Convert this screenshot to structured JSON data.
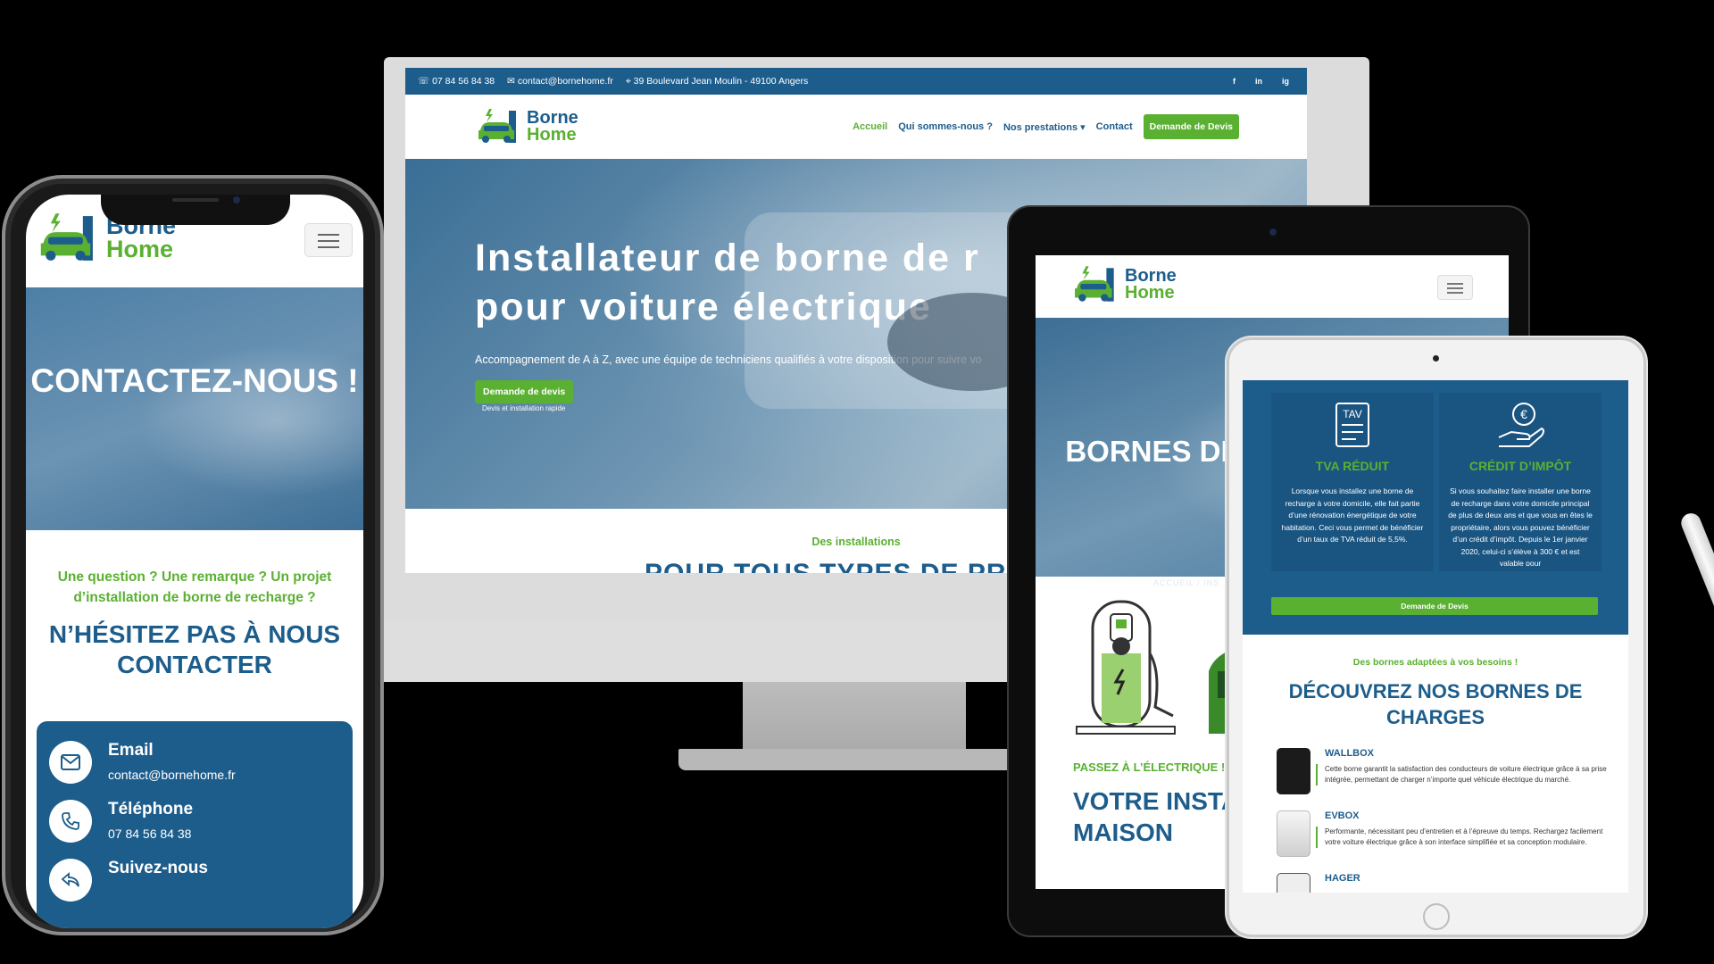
{
  "brand": {
    "line1": "Borne",
    "line2": "Home",
    "blue": "#1d5d8c",
    "green": "#5ab031"
  },
  "desktop": {
    "topbar": {
      "phone": "07 84 56 84 38",
      "email": "contact@bornehome.fr",
      "address": "39 Boulevard Jean Moulin - 49100 Angers",
      "social": [
        "f",
        "in",
        "ig"
      ]
    },
    "nav": {
      "items": [
        "Accueil",
        "Qui sommes-nous ?",
        "Nos prestations",
        "Contact"
      ],
      "cta": "Demande de Devis"
    },
    "hero": {
      "title_line1": "Installateur de borne de r",
      "title_line2": "pour voiture électrique",
      "subtitle": "Accompagnement de A à Z, avec une équipe de techniciens qualifiés à votre disposition pour suivre vo",
      "button": "Demande de devis",
      "note": "Devis et installation rapide"
    },
    "section": {
      "kicker": "Des installations",
      "title": "POUR TOUS TYPES DE PRO"
    }
  },
  "phone": {
    "hero_title": "CONTACTEZ-NOUS !",
    "question": "Une question ? Une remarque ? Un projet d’installation de borne de recharge ?",
    "cta_title": "N’HÉSITEZ PAS À NOUS CONTACTER",
    "contacts": [
      {
        "label": "Email",
        "value": "contact@bornehome.fr",
        "icon": "mail-icon"
      },
      {
        "label": "Téléphone",
        "value": "07 84 56 84 38",
        "icon": "phone-icon"
      },
      {
        "label": "Suivez-nous",
        "value": "",
        "icon": "share-icon"
      }
    ]
  },
  "tablet": {
    "hero_title": "BORNES DE MAISON",
    "breadcrumb": "ACCUEIL  /  INS",
    "kicker": "PASSEZ À L’ÉLECTRIQUE !",
    "title": "VOTRE INSTA BORNE DE R MAISON"
  },
  "ipad": {
    "columns": [
      {
        "heading": "TVA RÉDUIT",
        "icon_label": "TAV",
        "text": "Lorsque vous installez une borne de recharge à votre domicile, elle fait partie d’une rénovation énergétique de votre habitation. Ceci vous permet de bénéficier d’un taux de TVA réduit de 5,5%."
      },
      {
        "heading": "CRÉDIT D’IMPÔT",
        "icon_label": "€",
        "text": "Si vous souhaitez faire installer une borne de recharge dans votre domicile principal de plus de deux ans et que vous en êtes le propriétaire, alors vous pouvez bénéficier d’un crédit d’impôt. Depuis le 1er janvier 2020, celui-ci s’élève à 300 € et est valable pour"
      }
    ],
    "button": "Demande de Devis",
    "kicker": "Des bornes adaptées à vos besoins !",
    "title": "DÉCOUVREZ NOS BORNES DE CHARGES",
    "products": [
      {
        "name": "WALLBOX",
        "desc": "Cette borne garantit la satisfaction des conducteurs de voiture électrique grâce à sa prise intégrée, permettant de charger n’importe quel véhicule électrique du marché."
      },
      {
        "name": "EVBOX",
        "desc": "Performante, nécessitant peu d’entretien et à l’épreuve du temps. Rechargez facilement votre voiture électrique grâce à son interface simplifiée et sa conception modulaire."
      },
      {
        "name": "HAGER",
        "desc": ""
      }
    ]
  }
}
